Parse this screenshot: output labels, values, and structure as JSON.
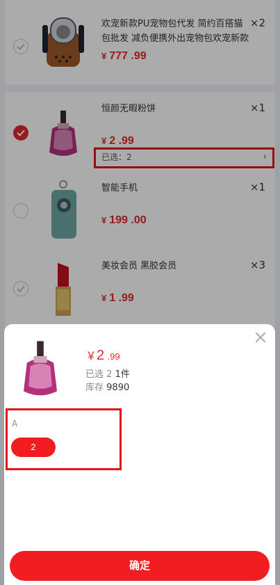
{
  "cart": {
    "items": [
      {
        "title": "欢宠新款PU宠物包代发 简约百搭猫包批发 减负便携外出宠物包欢宠新款P...",
        "qty": "×2",
        "currency": "¥",
        "price": "777 .99",
        "checked": false,
        "image": "pet-carrier-bag-image"
      },
      {
        "title": "恒颜无暇粉饼",
        "qty": "×1",
        "currency": "¥",
        "price": "2 .99",
        "checked": true,
        "image": "perfume-bottle-image",
        "selected_label": "已选：2"
      },
      {
        "title": "智能手机",
        "qty": "×1",
        "currency": "¥",
        "price": "199 .00",
        "checked": false,
        "image": "smartphone-image"
      },
      {
        "title": "美妆会员 黑胶会员",
        "qty": "×3",
        "currency": "¥",
        "price": "1 .99",
        "checked": false,
        "image": "lipstick-image"
      }
    ]
  },
  "sheet": {
    "price_currency": "￥",
    "price_int": "2",
    "price_dec": ".99",
    "selected_label": "已选",
    "selected_value": "2",
    "count": "1件",
    "stock_label": "库存",
    "stock_value": "9890",
    "spec_label": "A",
    "spec_option": "2",
    "confirm_label": "确定"
  },
  "colors": {
    "accent": "#f21d21",
    "price": "#e0292e",
    "highlight_box": "#e1141c"
  }
}
